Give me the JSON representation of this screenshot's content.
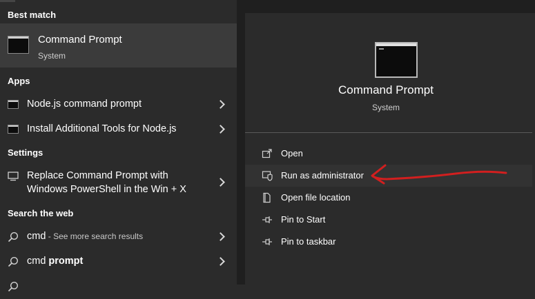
{
  "sections": {
    "best_match": "Best match",
    "apps": "Apps",
    "settings": "Settings",
    "search_web": "Search the web"
  },
  "best_match": {
    "title": "Command Prompt",
    "subtitle": "System",
    "icon": "command-prompt-icon"
  },
  "apps": [
    {
      "label": "Node.js command prompt",
      "icon": "command-prompt-icon"
    },
    {
      "label": "Install Additional Tools for Node.js",
      "icon": "command-prompt-icon"
    }
  ],
  "settings": [
    {
      "line1": "Replace Command Prompt with",
      "line2": "Windows PowerShell in the Win + X",
      "icon": "monitor-icon"
    }
  ],
  "web": [
    {
      "term": "cmd",
      "suffix": " - See more search results",
      "icon": "search-icon"
    },
    {
      "term": "cmd ",
      "bold": "prompt",
      "icon": "search-icon"
    }
  ],
  "detail": {
    "title": "Command Prompt",
    "subtitle": "System",
    "actions": [
      {
        "label": "Open",
        "icon": "open-icon"
      },
      {
        "label": "Run as administrator",
        "icon": "shield-icon"
      },
      {
        "label": "Open file location",
        "icon": "file-location-icon"
      },
      {
        "label": "Pin to Start",
        "icon": "pin-icon"
      },
      {
        "label": "Pin to taskbar",
        "icon": "pin-icon"
      }
    ]
  },
  "colors": {
    "panel_bg": "#2b2b2b",
    "best_match_bg": "#3b3b3b",
    "annotation_arrow": "#d21f1f"
  }
}
